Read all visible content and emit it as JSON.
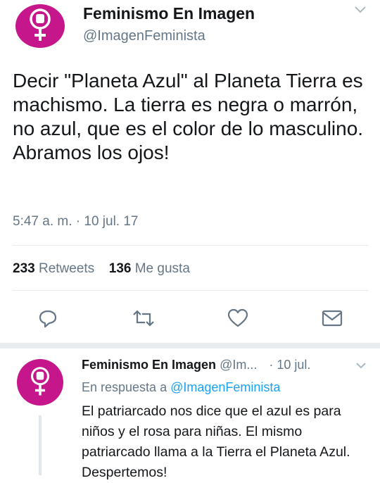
{
  "colors": {
    "avatar_bg": "#c5168b",
    "text": "#14171a",
    "secondary": "#657786",
    "link": "#1da1f2",
    "divider": "#e6ecf0"
  },
  "main_tweet": {
    "display_name": "Feminismo En Imagen",
    "handle": "@ImagenFeminista",
    "text": "Decir \"Planeta Azul\" al Planeta Tierra es machismo. La tierra es negra o marrón, no azul, que es el color de lo masculino. Abramos los ojos!",
    "timestamp": "5:47 a. m. · 10 jul. 17",
    "retweets_count": "233",
    "retweets_label": "Retweets",
    "likes_count": "136",
    "likes_label": "Me gusta",
    "icons": [
      "reply-icon",
      "retweet-icon",
      "like-icon",
      "direct-message-icon"
    ]
  },
  "reply_tweet": {
    "display_name": "Feminismo En Imagen",
    "handle": "@Im...",
    "date": "· 10 jul.",
    "reply_prefix": "En respuesta a",
    "reply_to": "@ImagenFeminista",
    "text": "El patriarcado nos dice que el azul es para niños y el rosa para niñas. El mismo patriarcado llama a la Tierra el Planeta Azul. Despertemos!"
  }
}
